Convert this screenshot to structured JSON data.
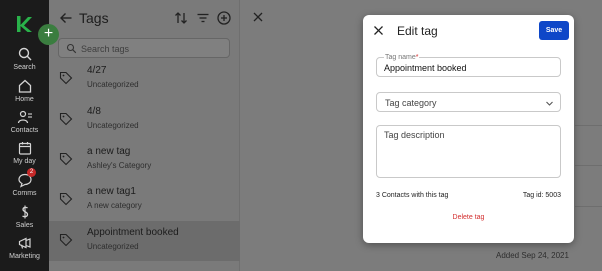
{
  "nav": {
    "items": [
      {
        "label": "Search",
        "icon": "search-icon"
      },
      {
        "label": "Home",
        "icon": "home-icon"
      },
      {
        "label": "Contacts",
        "icon": "contacts-icon"
      },
      {
        "label": "My day",
        "icon": "calendar-icon"
      },
      {
        "label": "Comms",
        "icon": "comms-icon",
        "badge": "2"
      },
      {
        "label": "Sales",
        "icon": "sales-icon"
      },
      {
        "label": "Marketing",
        "icon": "marketing-icon"
      }
    ],
    "accent": "#29b24a"
  },
  "tags_panel": {
    "title": "Tags",
    "search_placeholder": "Search tags",
    "tags": [
      {
        "name": "4/27",
        "category": "Uncategorized"
      },
      {
        "name": "4/8",
        "category": "Uncategorized"
      },
      {
        "name": "a new tag",
        "category": "Ashley's Category"
      },
      {
        "name": "a new tag1",
        "category": "A new category"
      },
      {
        "name": "Appointment booked",
        "category": "Uncategorized"
      }
    ]
  },
  "background": {
    "added_date": "Added Sep 24, 2021"
  },
  "modal": {
    "title": "Edit tag",
    "save_label": "Save",
    "tag_name_label": "Tag name",
    "tag_name_required": "*",
    "tag_name_value": "Appointment booked",
    "tag_category_placeholder": "Tag category",
    "tag_description_placeholder": "Tag description",
    "contacts_count_text": "3 Contacts with this tag",
    "tag_id_text": "Tag id: 5003",
    "delete_label": "Delete tag",
    "colors": {
      "primary": "#0e47c8",
      "danger": "#d32f2f"
    }
  }
}
